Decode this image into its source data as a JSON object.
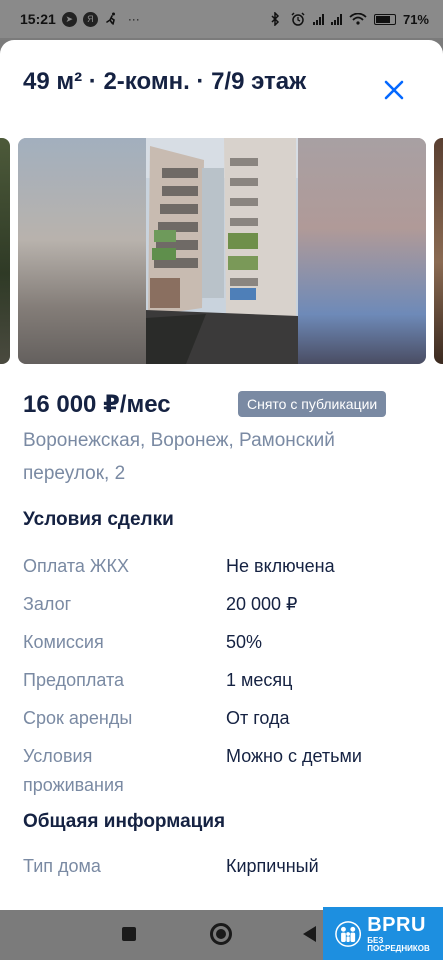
{
  "status_bar": {
    "time": "15:21",
    "more": "···",
    "battery_percent": "71",
    "battery_label": "71%",
    "left_icons": [
      "telegram-icon",
      "yandex-icon",
      "running-icon"
    ],
    "right_icons": [
      "bluetooth-icon",
      "alarm-icon",
      "signal-icon",
      "signal-icon",
      "wifi-icon",
      "battery-icon"
    ]
  },
  "listing": {
    "title": "49 м² · 2-комн. · 7/9 этаж",
    "price": "16 000 ₽/мес",
    "status_badge": "Снято с публикации",
    "address": "Воронежская, Воронеж, Рамонский переулок, 2"
  },
  "deal_terms": {
    "title": "Условия сделки",
    "rows": [
      {
        "label": "Оплата ЖКХ",
        "value": "Не включена"
      },
      {
        "label": "Залог",
        "value": "20 000 ₽"
      },
      {
        "label": "Комиссия",
        "value": "50%"
      },
      {
        "label": "Предоплата",
        "value": "1 месяц"
      },
      {
        "label": "Срок аренды",
        "value": "От года"
      },
      {
        "label": "Условия проживания",
        "value": "Можно с детьми"
      }
    ]
  },
  "general_info": {
    "title": "Общаяя информация",
    "rows": [
      {
        "label": "Тип дома",
        "value": "Кирпичный"
      }
    ]
  },
  "watermark": {
    "brand": "BPRU",
    "subtitle": "БЕЗ ПОСРЕДНИКОВ"
  },
  "colors": {
    "title": "#152242",
    "muted": "#7a8aa3",
    "accent": "#0468ff",
    "badge": "#7a8aa3",
    "watermark": "#1d8fe0"
  }
}
